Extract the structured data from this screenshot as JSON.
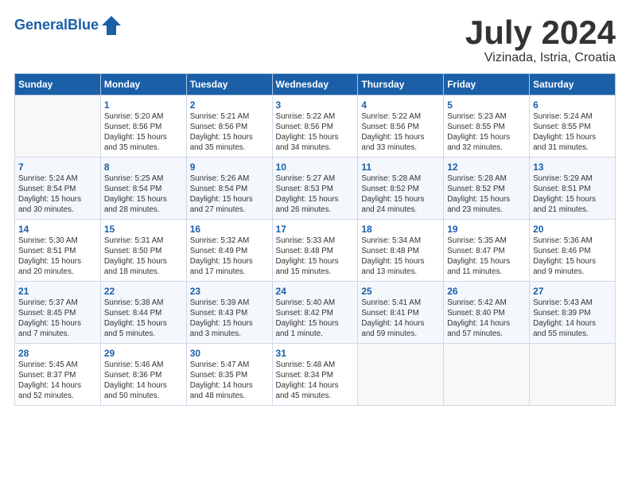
{
  "header": {
    "logo_general": "General",
    "logo_blue": "Blue",
    "month": "July 2024",
    "location": "Vizinada, Istria, Croatia"
  },
  "days_of_week": [
    "Sunday",
    "Monday",
    "Tuesday",
    "Wednesday",
    "Thursday",
    "Friday",
    "Saturday"
  ],
  "weeks": [
    [
      {
        "day": "",
        "content": ""
      },
      {
        "day": "1",
        "content": "Sunrise: 5:20 AM\nSunset: 8:56 PM\nDaylight: 15 hours\nand 35 minutes."
      },
      {
        "day": "2",
        "content": "Sunrise: 5:21 AM\nSunset: 8:56 PM\nDaylight: 15 hours\nand 35 minutes."
      },
      {
        "day": "3",
        "content": "Sunrise: 5:22 AM\nSunset: 8:56 PM\nDaylight: 15 hours\nand 34 minutes."
      },
      {
        "day": "4",
        "content": "Sunrise: 5:22 AM\nSunset: 8:56 PM\nDaylight: 15 hours\nand 33 minutes."
      },
      {
        "day": "5",
        "content": "Sunrise: 5:23 AM\nSunset: 8:55 PM\nDaylight: 15 hours\nand 32 minutes."
      },
      {
        "day": "6",
        "content": "Sunrise: 5:24 AM\nSunset: 8:55 PM\nDaylight: 15 hours\nand 31 minutes."
      }
    ],
    [
      {
        "day": "7",
        "content": "Sunrise: 5:24 AM\nSunset: 8:54 PM\nDaylight: 15 hours\nand 30 minutes."
      },
      {
        "day": "8",
        "content": "Sunrise: 5:25 AM\nSunset: 8:54 PM\nDaylight: 15 hours\nand 28 minutes."
      },
      {
        "day": "9",
        "content": "Sunrise: 5:26 AM\nSunset: 8:54 PM\nDaylight: 15 hours\nand 27 minutes."
      },
      {
        "day": "10",
        "content": "Sunrise: 5:27 AM\nSunset: 8:53 PM\nDaylight: 15 hours\nand 26 minutes."
      },
      {
        "day": "11",
        "content": "Sunrise: 5:28 AM\nSunset: 8:52 PM\nDaylight: 15 hours\nand 24 minutes."
      },
      {
        "day": "12",
        "content": "Sunrise: 5:28 AM\nSunset: 8:52 PM\nDaylight: 15 hours\nand 23 minutes."
      },
      {
        "day": "13",
        "content": "Sunrise: 5:29 AM\nSunset: 8:51 PM\nDaylight: 15 hours\nand 21 minutes."
      }
    ],
    [
      {
        "day": "14",
        "content": "Sunrise: 5:30 AM\nSunset: 8:51 PM\nDaylight: 15 hours\nand 20 minutes."
      },
      {
        "day": "15",
        "content": "Sunrise: 5:31 AM\nSunset: 8:50 PM\nDaylight: 15 hours\nand 18 minutes."
      },
      {
        "day": "16",
        "content": "Sunrise: 5:32 AM\nSunset: 8:49 PM\nDaylight: 15 hours\nand 17 minutes."
      },
      {
        "day": "17",
        "content": "Sunrise: 5:33 AM\nSunset: 8:48 PM\nDaylight: 15 hours\nand 15 minutes."
      },
      {
        "day": "18",
        "content": "Sunrise: 5:34 AM\nSunset: 8:48 PM\nDaylight: 15 hours\nand 13 minutes."
      },
      {
        "day": "19",
        "content": "Sunrise: 5:35 AM\nSunset: 8:47 PM\nDaylight: 15 hours\nand 11 minutes."
      },
      {
        "day": "20",
        "content": "Sunrise: 5:36 AM\nSunset: 8:46 PM\nDaylight: 15 hours\nand 9 minutes."
      }
    ],
    [
      {
        "day": "21",
        "content": "Sunrise: 5:37 AM\nSunset: 8:45 PM\nDaylight: 15 hours\nand 7 minutes."
      },
      {
        "day": "22",
        "content": "Sunrise: 5:38 AM\nSunset: 8:44 PM\nDaylight: 15 hours\nand 5 minutes."
      },
      {
        "day": "23",
        "content": "Sunrise: 5:39 AM\nSunset: 8:43 PM\nDaylight: 15 hours\nand 3 minutes."
      },
      {
        "day": "24",
        "content": "Sunrise: 5:40 AM\nSunset: 8:42 PM\nDaylight: 15 hours\nand 1 minute."
      },
      {
        "day": "25",
        "content": "Sunrise: 5:41 AM\nSunset: 8:41 PM\nDaylight: 14 hours\nand 59 minutes."
      },
      {
        "day": "26",
        "content": "Sunrise: 5:42 AM\nSunset: 8:40 PM\nDaylight: 14 hours\nand 57 minutes."
      },
      {
        "day": "27",
        "content": "Sunrise: 5:43 AM\nSunset: 8:39 PM\nDaylight: 14 hours\nand 55 minutes."
      }
    ],
    [
      {
        "day": "28",
        "content": "Sunrise: 5:45 AM\nSunset: 8:37 PM\nDaylight: 14 hours\nand 52 minutes."
      },
      {
        "day": "29",
        "content": "Sunrise: 5:46 AM\nSunset: 8:36 PM\nDaylight: 14 hours\nand 50 minutes."
      },
      {
        "day": "30",
        "content": "Sunrise: 5:47 AM\nSunset: 8:35 PM\nDaylight: 14 hours\nand 48 minutes."
      },
      {
        "day": "31",
        "content": "Sunrise: 5:48 AM\nSunset: 8:34 PM\nDaylight: 14 hours\nand 45 minutes."
      },
      {
        "day": "",
        "content": ""
      },
      {
        "day": "",
        "content": ""
      },
      {
        "day": "",
        "content": ""
      }
    ]
  ]
}
